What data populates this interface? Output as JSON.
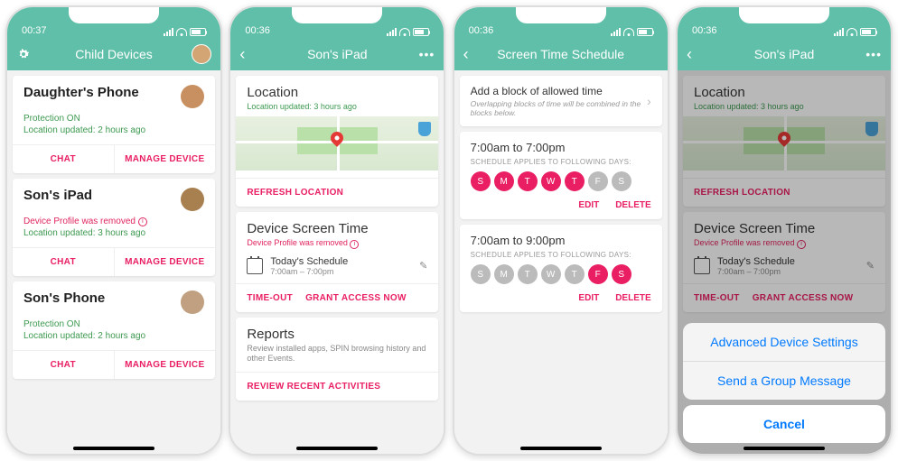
{
  "screen1": {
    "time": "00:37",
    "title": "Child Devices",
    "devices": [
      {
        "name": "Daughter's Phone",
        "status": "Protection ON",
        "loc": "Location updated: 2 hours ago",
        "warn": null
      },
      {
        "name": "Son's iPad",
        "status": null,
        "loc": "Location updated: 3 hours ago",
        "warn": "Device Profile was removed"
      },
      {
        "name": "Son's Phone",
        "status": "Protection ON",
        "loc": "Location updated: 2 hours ago",
        "warn": null
      }
    ],
    "chat_label": "CHAT",
    "manage_label": "MANAGE DEVICE"
  },
  "screen2": {
    "time": "00:36",
    "title": "Son's iPad",
    "location": {
      "title": "Location",
      "sub": "Location updated: 3 hours ago",
      "refresh": "REFRESH LOCATION"
    },
    "screentime": {
      "title": "Device Screen Time",
      "warn": "Device Profile was removed",
      "sched_title": "Today's Schedule",
      "sched_time": "7:00am – 7:00pm",
      "timeout": "TIME-OUT",
      "grant": "GRANT ACCESS NOW"
    },
    "reports": {
      "title": "Reports",
      "desc": "Review installed apps, SPIN browsing history and other Events.",
      "review": "REVIEW RECENT ACTIVITIES"
    }
  },
  "screen3": {
    "time": "00:36",
    "title": "Screen Time Schedule",
    "add": {
      "l1": "Add a block of allowed time",
      "l2": "Overlapping blocks of time will be combined in the blocks below."
    },
    "days_label": "SCHEDULE APPLIES TO FOLLOWING DAYS:",
    "blocks": [
      {
        "range": "7:00am to 7:00pm",
        "days": [
          "S",
          "M",
          "T",
          "W",
          "T",
          "F",
          "S"
        ],
        "active": [
          true,
          true,
          true,
          true,
          true,
          false,
          false
        ]
      },
      {
        "range": "7:00am to 9:00pm",
        "days": [
          "S",
          "M",
          "T",
          "W",
          "T",
          "F",
          "S"
        ],
        "active": [
          false,
          false,
          false,
          false,
          false,
          true,
          true
        ]
      }
    ],
    "edit": "EDIT",
    "delete": "DELETE"
  },
  "screen4": {
    "time": "00:36",
    "title": "Son's iPad",
    "sheet": {
      "opt1": "Advanced Device Settings",
      "opt2": "Send a Group Message",
      "cancel": "Cancel"
    }
  }
}
